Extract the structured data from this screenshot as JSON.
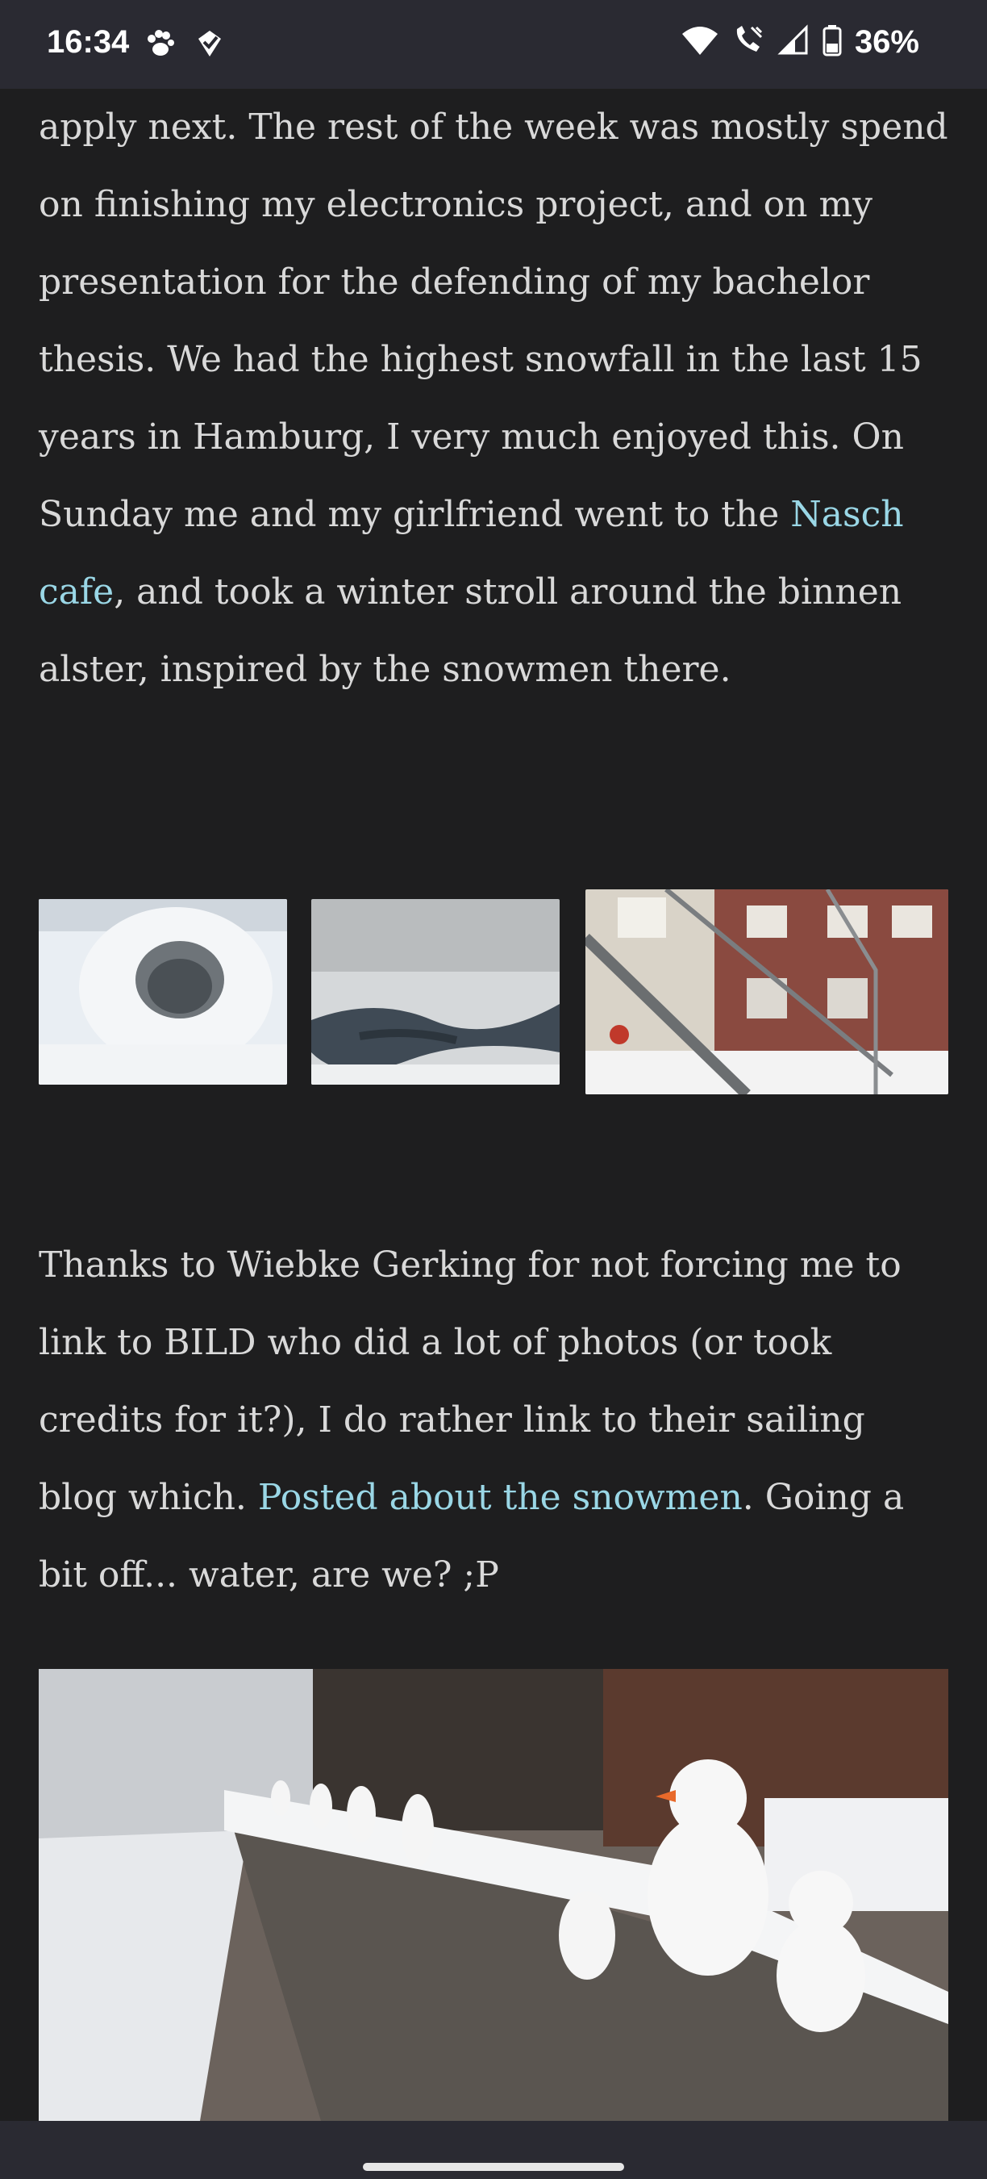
{
  "status_bar": {
    "time": "16:34",
    "left_icons": [
      "paw-icon",
      "shield-check-icon"
    ],
    "right_icons": [
      "wifi-icon",
      "call-icon",
      "signal-icon",
      "battery-icon"
    ],
    "battery_percent": "36%"
  },
  "article": {
    "paragraph1": {
      "text_before_link": "apply next. The rest of the week was mostly spend on finishing my electronics project, and on my presentation for the defending of my bachelor thesis. We had the highest snowfall in the last 15 years in Hamburg, I very much enjoyed this. On Sunday me and my girlfriend went to the ",
      "link_text": "Nasch cafe",
      "text_after_link": ", and took a winter stroll around the binnen alster, inspired by the snowmen there."
    },
    "thumbnails": [
      {
        "name": "snow-cave-photo"
      },
      {
        "name": "frozen-lake-photo"
      },
      {
        "name": "building-railing-photo"
      }
    ],
    "paragraph2": {
      "text_before_link": "Thanks to Wiebke Gerking for not forcing me to link to BILD who did a lot of photos (or took credits for it?), I do rather link to their sailing blog which. ",
      "link_text": "Posted about the snowmen",
      "text_after_link": ". Going a bit off... water, are we? ;P"
    },
    "main_photo": {
      "name": "snowmen-on-bridge-photo"
    }
  },
  "colors": {
    "background": "#1e1e1f",
    "text": "#d9d9d9",
    "link": "#9ad7e6",
    "bars": "#2a2a32"
  }
}
